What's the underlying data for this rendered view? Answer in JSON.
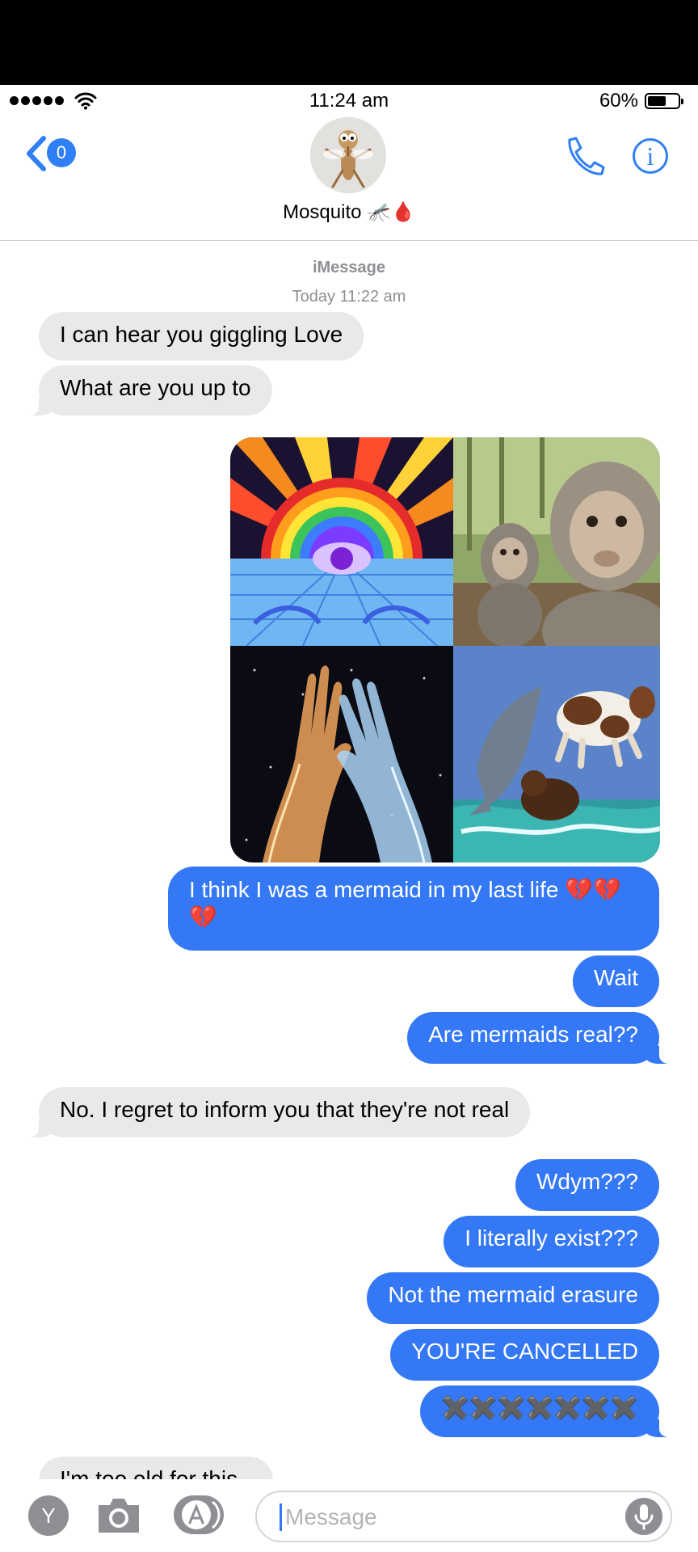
{
  "status_bar": {
    "time": "11:24 am",
    "battery": "60%",
    "battery_level": 0.6
  },
  "header": {
    "back_badge": "0",
    "contact_name": "Mosquito 🦟🩸"
  },
  "thread": {
    "service": "iMessage",
    "timestamp": "Today 11:22 am"
  },
  "messages": [
    {
      "dir": "in",
      "text": "I can hear you giggling Love"
    },
    {
      "dir": "in",
      "text": "What are you up to"
    },
    {
      "dir": "out",
      "type": "image-collage",
      "tiles": [
        "psychedelic eye rainbow",
        "monkey selfie",
        "glowing cosmic hands",
        "dolphin cow dog jumping"
      ]
    },
    {
      "dir": "out",
      "text": "I think I was a mermaid in my last life 💔💔",
      "text2": "💔"
    },
    {
      "dir": "out",
      "text": "Wait"
    },
    {
      "dir": "out",
      "text": "Are mermaids real??"
    },
    {
      "dir": "in",
      "text": "No. I regret to inform you that they're not real"
    },
    {
      "dir": "out",
      "text": "Wdym???"
    },
    {
      "dir": "out",
      "text": "I literally exist???"
    },
    {
      "dir": "out",
      "text": "Not the mermaid erasure"
    },
    {
      "dir": "out",
      "text": "YOU'RE CANCELLED"
    },
    {
      "dir": "out",
      "text": "✖️✖️✖️✖️✖️✖️✖️"
    },
    {
      "dir": "in",
      "text": "I'm too old for this"
    }
  ],
  "composer": {
    "app_button": "Y",
    "placeholder": "Message"
  },
  "colors": {
    "outgoing": "#3478f6",
    "incoming": "#e9e9eb",
    "accent": "#2f7ff5"
  }
}
